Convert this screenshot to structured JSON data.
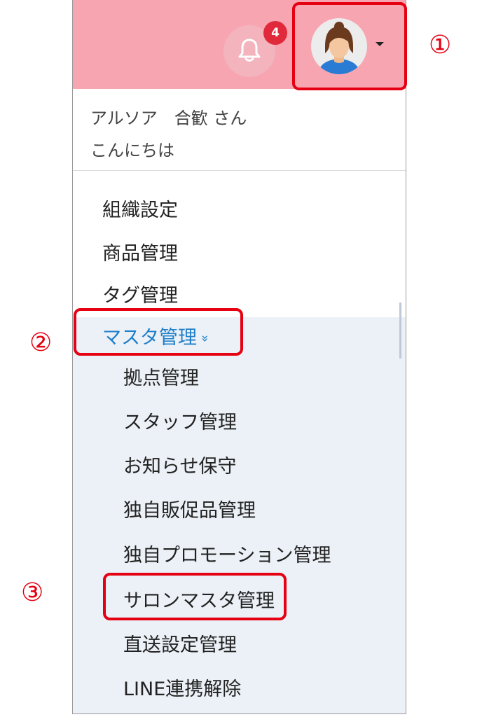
{
  "header": {
    "notification_count": "4"
  },
  "user": {
    "name_line": "アルソア　合歓 さん",
    "greeting_line": "こんにちは"
  },
  "menu": {
    "items": [
      "組織設定",
      "商品管理",
      "タグ管理"
    ],
    "master": {
      "label": "マスタ管理",
      "chevron": "»",
      "children": [
        "拠点管理",
        "スタッフ管理",
        "お知らせ保守",
        "独自販促品管理",
        "独自プロモーション管理",
        "サロンマスタ管理",
        "直送設定管理",
        "LINE連携解除"
      ]
    }
  },
  "callouts": {
    "c1": "①",
    "c2": "②",
    "c3": "③"
  },
  "colors": {
    "header_bg": "#f7a5b1",
    "highlight": "#e50012",
    "active_link": "#1f7fc9",
    "submenu_bg": "#ecf1f7"
  }
}
